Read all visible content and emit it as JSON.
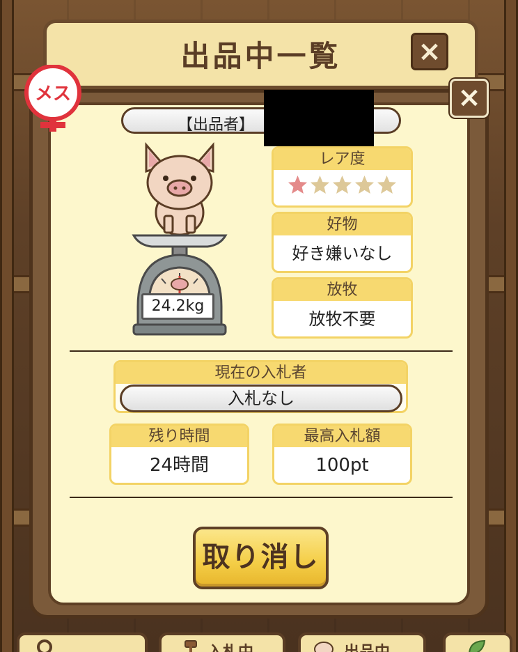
{
  "header": {
    "title": "出品中一覧",
    "close_icon": "×"
  },
  "dialog": {
    "close_icon": "×",
    "gender_badge": "メス",
    "seller_label": "【出品者】"
  },
  "pig": {
    "weight": "24.2kg"
  },
  "rarity": {
    "label": "レア度",
    "filled_stars": 1,
    "total_stars": 5,
    "filled_color": "#e48a8a",
    "empty_color": "#ddc898"
  },
  "favorite": {
    "label": "好物",
    "value": "好き嫌いなし"
  },
  "grazing": {
    "label": "放牧",
    "value": "放牧不要"
  },
  "current_bidder": {
    "label": "現在の入札者",
    "value": "入札なし"
  },
  "remaining_time": {
    "label": "残り時間",
    "value": "24時間"
  },
  "highest_bid": {
    "label": "最高入札額",
    "value": "100pt"
  },
  "actions": {
    "cancel_label": "取り消し"
  },
  "tabs": [
    {
      "label": "",
      "icon": "search-icon"
    },
    {
      "label": "入札中",
      "icon": "hammer-icon"
    },
    {
      "label": "出品中",
      "icon": "pig-icon"
    },
    {
      "label": "",
      "icon": "leaf-icon"
    }
  ],
  "colors": {
    "accent_yellow": "#f7d970",
    "frame_brown": "#5d3f24",
    "panel_cream": "#fdf7cc"
  }
}
